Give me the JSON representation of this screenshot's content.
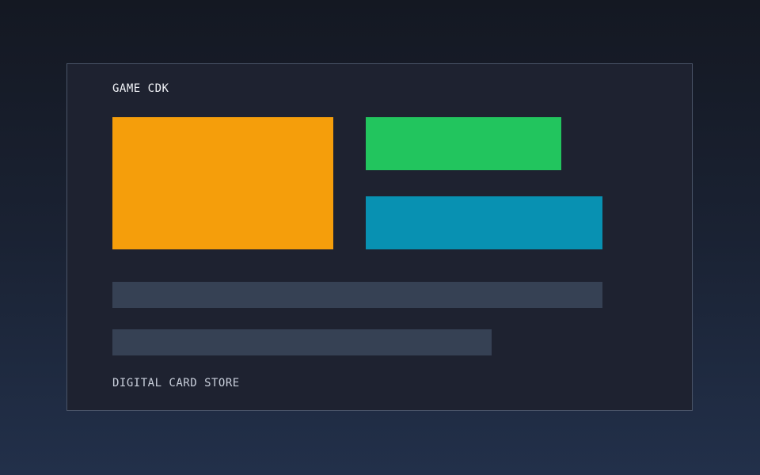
{
  "card": {
    "title": "GAME CDK",
    "footer": "DIGITAL CARD STORE"
  },
  "tiles": [
    {
      "name": "orange-tile",
      "color": "#f59e0b"
    },
    {
      "name": "green-tile",
      "color": "#22c55e"
    },
    {
      "name": "teal-tile",
      "color": "#0891b2"
    }
  ],
  "placeholder_bars": {
    "color": "#364154"
  }
}
